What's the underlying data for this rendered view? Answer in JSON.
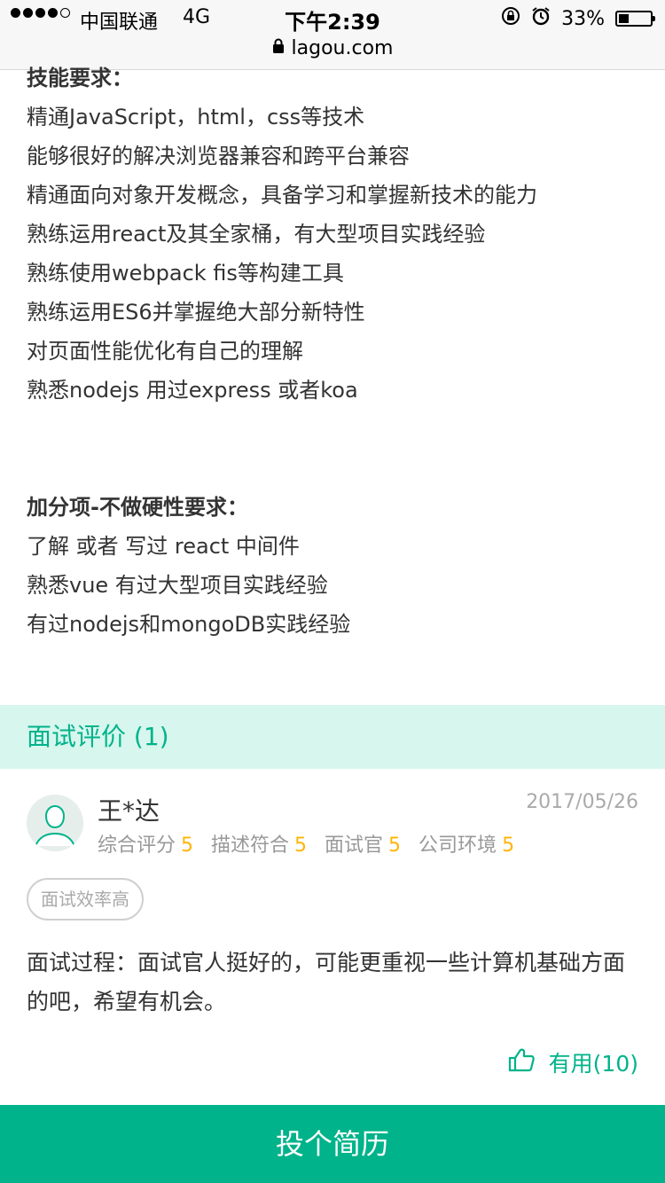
{
  "status_bar": {
    "carrier": "中国联通",
    "network": "4G",
    "time": "下午2:39",
    "battery_text": "33%",
    "battery_level": 0.33
  },
  "url_bar": {
    "url": "lagou.com"
  },
  "requirements": {
    "skills_heading": "技能要求：",
    "skills": [
      "精通JavaScript，html，css等技术",
      "能够很好的解决浏览器兼容和跨平台兼容",
      "精通面向对象开发概念，具备学习和掌握新技术的能力",
      "熟练运用react及其全家桶，有大型项目实践经验",
      "熟练使用webpack fis等构建工具",
      "熟练运用ES6并掌握绝大部分新特性",
      "对页面性能优化有自己的理解",
      "熟悉nodejs 用过express 或者koa"
    ],
    "bonus_heading": "加分项-不做硬性要求：",
    "bonus": [
      "了解 或者 写过 react 中间件",
      "熟悉vue 有过大型项目实践经验",
      "有过nodejs和mongoDB实践经验"
    ]
  },
  "reviews": {
    "header": "面试评价 (1)",
    "items": [
      {
        "name": "王*达",
        "date": "2017/05/26",
        "ratings": [
          {
            "label": "综合评分",
            "score": "5"
          },
          {
            "label": "描述符合",
            "score": "5"
          },
          {
            "label": "面试官",
            "score": "5"
          },
          {
            "label": "公司环境",
            "score": "5"
          }
        ],
        "tag": "面试效率高",
        "text": "面试过程：面试官人挺好的，可能更重视一些计算机基础方面的吧，希望有机会。",
        "useful": "有用(10)"
      }
    ]
  },
  "apply_button": "投个简历",
  "colors": {
    "brand": "#00b38a",
    "section_bg": "#d7f6ee",
    "score": "#ffb508"
  }
}
